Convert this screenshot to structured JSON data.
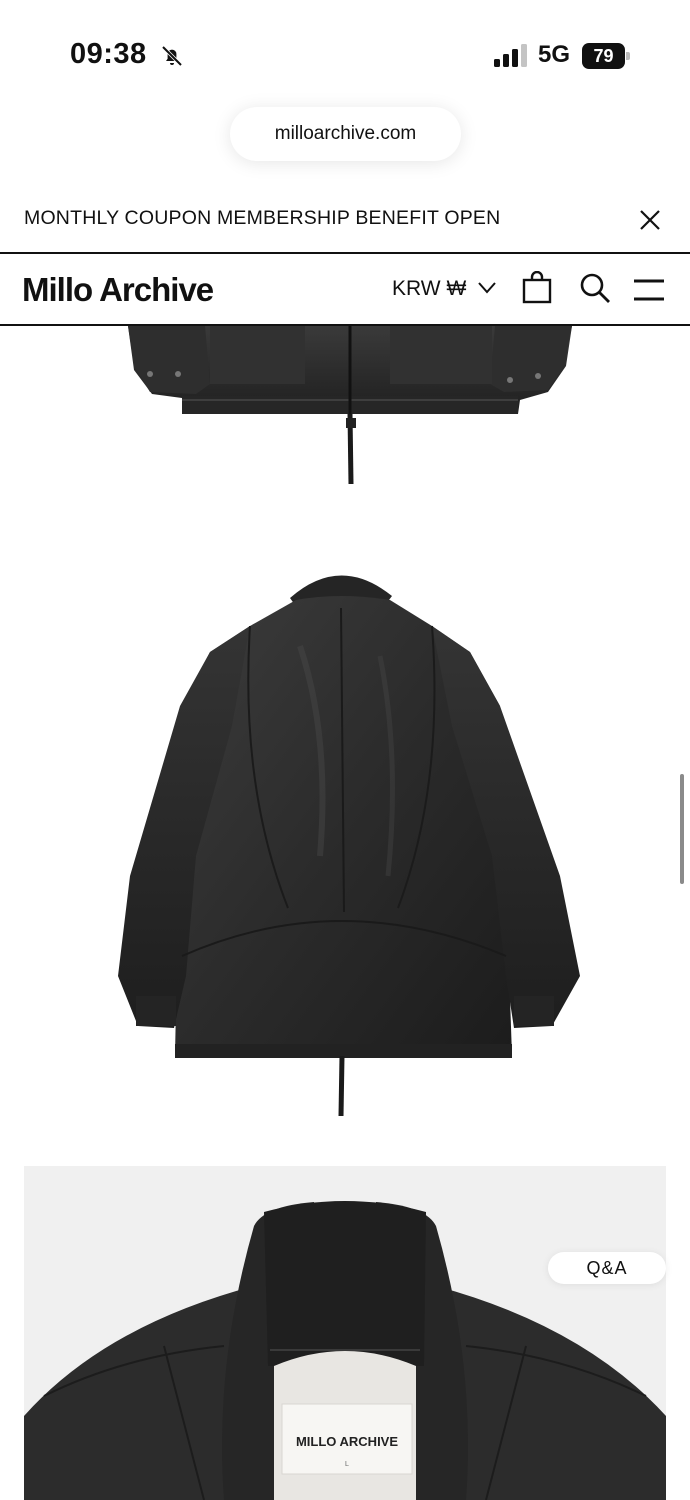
{
  "status_bar": {
    "time": "09:38",
    "network": "5G",
    "battery": "79",
    "icons": [
      "bell-slash-icon",
      "signal-icon",
      "battery-icon"
    ]
  },
  "browser": {
    "url": "milloarchive.com"
  },
  "promo": {
    "text": "MONTHLY COUPON MEMBERSHIP BENEFIT OPEN",
    "close_icon": "close-icon"
  },
  "header": {
    "logo": "Millo Archive",
    "currency": "KRW ₩",
    "icons": [
      "chevron-down-icon",
      "shopping-bag-icon",
      "search-icon",
      "menu-icon"
    ]
  },
  "gallery": {
    "label_text": "MILLO ARCHIVE",
    "label_size": "L"
  },
  "qa": {
    "label": "Q&A"
  },
  "colors": {
    "text": "#111111",
    "background": "#ffffff",
    "leather": "#2a2a2a",
    "photo_bg": "#f2f2f2"
  }
}
